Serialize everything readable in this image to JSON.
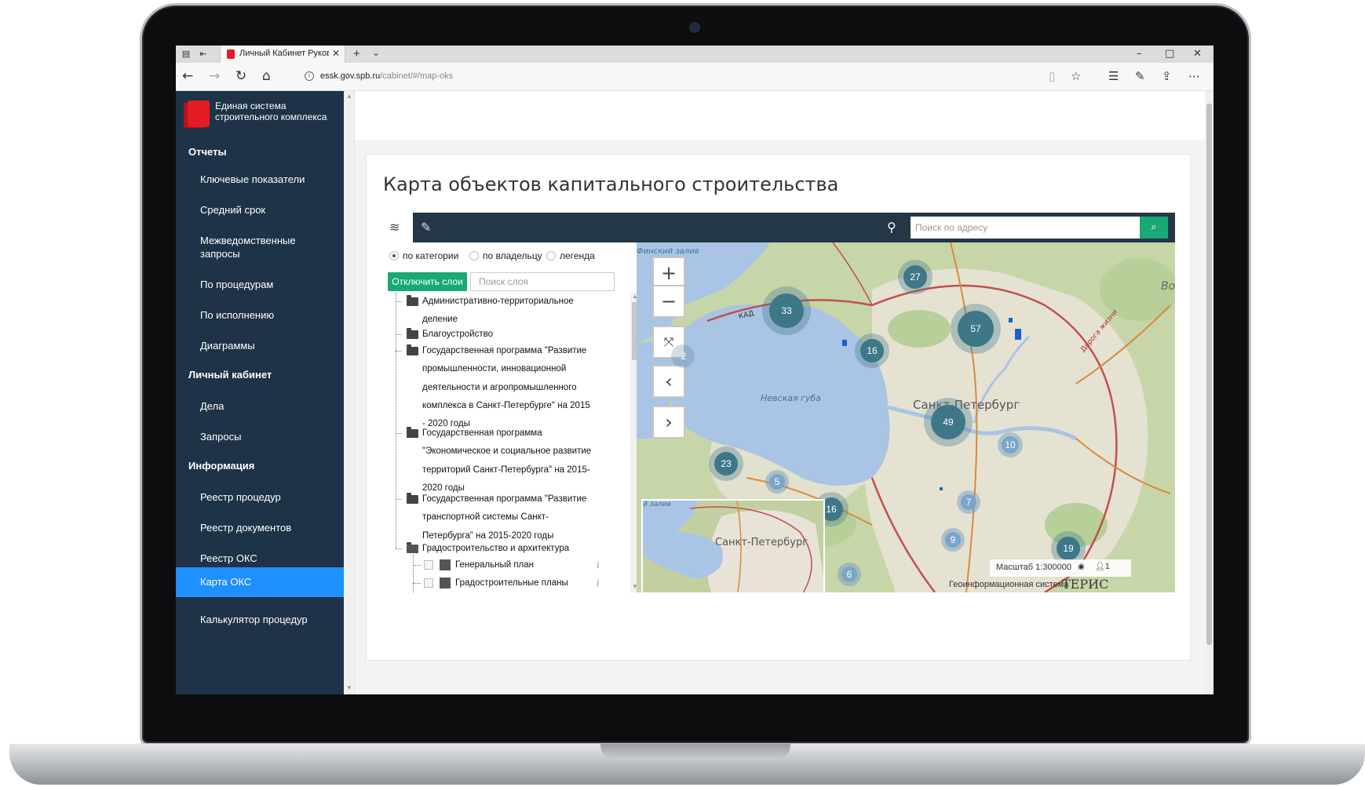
{
  "browser": {
    "tab_title": "Личный Кабинет Руков",
    "url_host": "essk.gov.spb.ru",
    "url_path": "/cabinet/#/map-oks"
  },
  "sidebar": {
    "logo_text": "Единая система строительного комплекса",
    "sections": [
      {
        "title": "Отчеты",
        "items": [
          "Ключевые показатели",
          "Средний срок",
          "Межведомственные запросы",
          "По процедурам",
          "По исполнению",
          "Диаграммы"
        ]
      },
      {
        "title": "Личный кабинет",
        "items": [
          "Дела",
          "Запросы"
        ]
      },
      {
        "title": "Информация",
        "items": [
          "Реестр процедур",
          "Реестр документов",
          "Реестр ОКС",
          "Карта ОКС",
          "Калькулятор процедур"
        ]
      }
    ],
    "active_item": "Карта ОКС"
  },
  "page": {
    "title": "Карта объектов капитального строительства"
  },
  "map_toolbar": {
    "address_placeholder": "Поиск по адресу",
    "icons": [
      "layers-icon",
      "pencil-icon",
      "location-pin-icon",
      "search-icon"
    ]
  },
  "layers_panel": {
    "radios": [
      {
        "label": "по категории",
        "selected": true
      },
      {
        "label": "по владельцу",
        "selected": false
      },
      {
        "label": "легенда",
        "selected": false
      }
    ],
    "disable_button": "Отключить слои",
    "search_placeholder": "Поиск слоя",
    "tree": [
      {
        "lines": [
          "Административно-территориальное",
          "деление"
        ],
        "type": "folder"
      },
      {
        "lines": [
          "Благоустройство"
        ],
        "type": "folder"
      },
      {
        "lines": [
          "Государственная программа \"Развитие",
          "промышленности, инновационной",
          "деятельности и агропромышленного",
          "комплекса в Санкт-Петербурге\" на 2015",
          "- 2020 годы"
        ],
        "type": "folder"
      },
      {
        "lines": [
          "Государственная программа",
          "\"Экономическое и социальное развитие",
          "территорий Санкт-Петербурга\" на 2015-",
          "2020 годы"
        ],
        "type": "folder"
      },
      {
        "lines": [
          "Государственная программа \"Развитие",
          "транспортной системы Санкт-",
          "Петербурга\" на 2015-2020 годы"
        ],
        "type": "folder"
      },
      {
        "lines": [
          "Градостроительство и архитектура"
        ],
        "type": "folder-open"
      },
      {
        "lines": [
          "Генеральный план"
        ],
        "type": "layer"
      },
      {
        "lines": [
          "Градостроительные планы"
        ],
        "type": "layer"
      }
    ]
  },
  "map": {
    "clusters": [
      {
        "label": "33"
      },
      {
        "label": "27"
      },
      {
        "label": "57"
      },
      {
        "label": "16"
      },
      {
        "label": "2"
      },
      {
        "label": "49"
      },
      {
        "label": "10"
      },
      {
        "label": "23"
      },
      {
        "label": "5"
      },
      {
        "label": "16"
      },
      {
        "label": "7"
      },
      {
        "label": "9"
      },
      {
        "label": "19"
      },
      {
        "label": "6"
      }
    ],
    "labels": {
      "gulf": "Невская губа",
      "city": "Санкт-Петербург",
      "gulf_top": "Финский залив",
      "kad": "КАД",
      "minimap_city": "Санкт-Петербург",
      "minimap_top": "й залив",
      "road": "Дорога жизни",
      "edge": "Во"
    },
    "scale": "Масштаб 1:300000",
    "users": "1",
    "footer": "Геоинформационная система",
    "footer_logo": "ТЕРИС",
    "colors": {
      "water": "#a9c4e4",
      "land": "#c7d6a8",
      "urban": "#e8e3d6",
      "cluster": "#3d7788"
    }
  }
}
